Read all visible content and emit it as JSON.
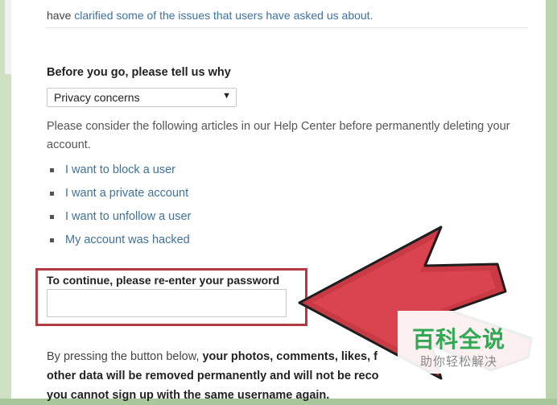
{
  "intro": {
    "prefix": "have ",
    "link": "clarified some of the issues that users have asked us about."
  },
  "form": {
    "heading": "Before you go, please tell us why",
    "reason_selected": "Privacy concerns",
    "consider_text": "Please consider the following articles in our Help Center before permanently deleting your account.",
    "articles": [
      "I want to block a user",
      "I want a private account",
      "I want to unfollow a user",
      "My account was hacked"
    ],
    "password_label": "To continue, please re-enter your password",
    "password_value": "",
    "warning_prefix": "By pressing the button below, ",
    "warning_bold_1": "your photos, comments, likes, f",
    "warning_bold_2": "other data will be removed permanently and will not be reco",
    "warning_bold_3": "you cannot sign up with the same username again."
  },
  "watermark": {
    "main": "百科全说",
    "sub": "助你轻松解决"
  },
  "colors": {
    "link": "#3f729b",
    "highlight_red": "#c0392b",
    "watermark_green": "#31a853"
  },
  "icons": [
    "pointer-arrow",
    "dropdown-arrow-icon",
    "bullet-icon"
  ]
}
